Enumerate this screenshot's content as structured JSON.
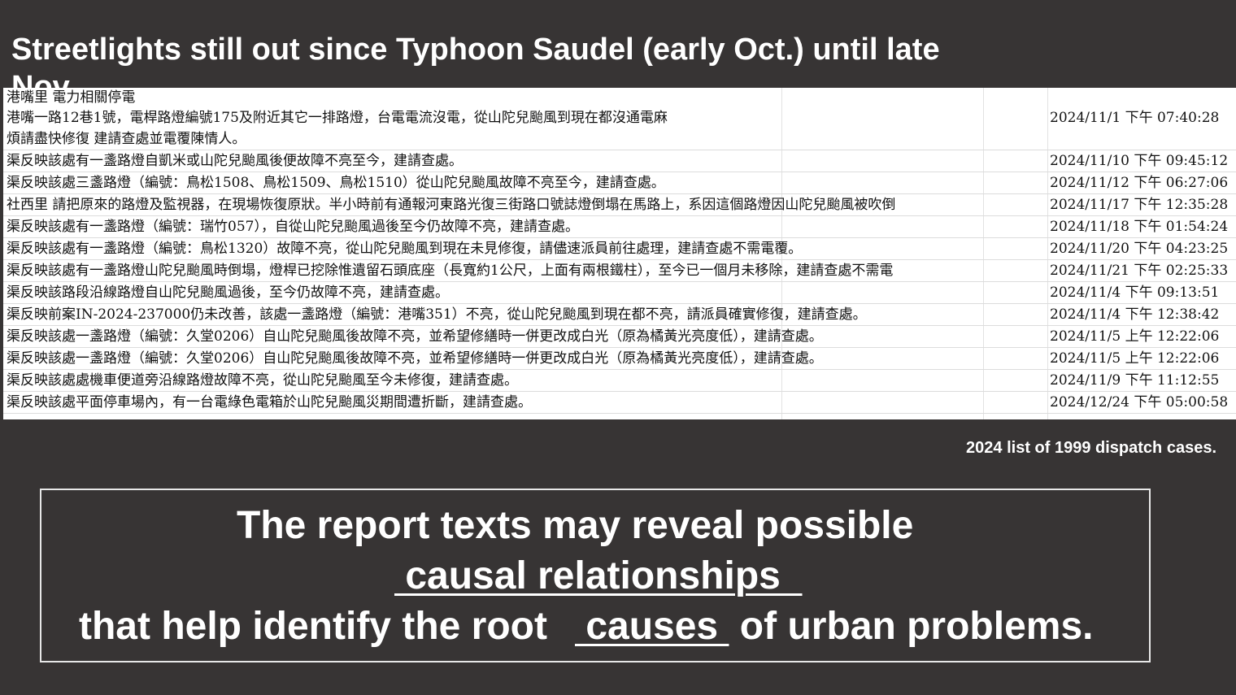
{
  "title": "Streetlights still out since Typhoon Saudel (early Oct.) until late Nov.",
  "sheet": {
    "category_line": "港嘴里 電力相關停電",
    "rows": [
      {
        "text": "港嘴一路12巷1號，電桿路燈編號175及附近其它一排路燈，台電電流沒電，從山陀兒颱風到現在都沒通電麻",
        "text2": "煩請盡快修復 建請查處並電覆陳情人。",
        "date": "2024/11/1 下午 07:40:28"
      },
      {
        "text": "渠反映該處有一盞路燈自凱米或山陀兒颱風後便故障不亮至今，建請查處。",
        "date": "2024/11/10 下午 09:45:12"
      },
      {
        "text": "渠反映該處三盞路燈（編號：鳥松1508、鳥松1509、鳥松1510）從山陀兒颱風故障不亮至今，建請查處。",
        "date": "2024/11/12 下午 06:27:06"
      },
      {
        "text": "社西里 請把原來的路燈及監視器，在現場恢復原狀。半小時前有通報河東路光復三街路口號誌燈倒塌在馬路上，系因這個路燈因山陀兒颱風被吹倒",
        "date": "2024/11/17 下午 12:35:28"
      },
      {
        "text": "渠反映該處有一盞路燈（編號：瑞竹057），自從山陀兒颱風過後至今仍故障不亮，建請查處。",
        "date": "2024/11/18 下午 01:54:24"
      },
      {
        "text": "渠反映該處有一盞路燈（編號：鳥松1320）故障不亮，從山陀兒颱風到現在未見修復，請儘速派員前往處理，建請查處不需電覆。",
        "date": "2024/11/20 下午 04:23:25"
      },
      {
        "text": "渠反映該處有一盞路燈山陀兒颱風時倒塌，燈桿已挖除惟遺留石頭底座（長寬約1公尺，上面有兩根鐵柱），至今已一個月未移除，建請查處不需電",
        "date": "2024/11/21 下午 02:25:33"
      },
      {
        "text": "渠反映該路段沿線路燈自山陀兒颱風過後，至今仍故障不亮，建請查處。",
        "date": "2024/11/4 下午 09:13:51"
      },
      {
        "text": "渠反映前案IN-2024-237000仍未改善，該處一盞路燈（編號：港嘴351）不亮，從山陀兒颱風到現在都不亮，請派員確實修復，建請查處。",
        "date": "2024/11/4 下午 12:38:42"
      },
      {
        "text": "渠反映該處一盞路燈（編號：久堂0206）自山陀兒颱風後故障不亮，並希望修繕時一併更改成白光（原為橘黃光亮度低），建請查處。",
        "date": "2024/11/5 上午 12:22:06"
      },
      {
        "text": "渠反映該處一盞路燈（編號：久堂0206）自山陀兒颱風後故障不亮，並希望修繕時一併更改成白光（原為橘黃光亮度低），建請查處。",
        "date": "2024/11/5 上午 12:22:06"
      },
      {
        "text": "渠反映該處處機車便道旁沿線路燈故障不亮，從山陀兒颱風至今未修復，建請查處。",
        "date": "2024/11/9 下午 11:12:55"
      },
      {
        "text": "渠反映該處平面停車場內，有一台電綠色電箱於山陀兒颱風災期間遭折斷，建請查處。",
        "date": "2024/12/24 下午 05:00:58"
      }
    ]
  },
  "caption": "2024 list of 1999 dispatch cases.",
  "callout": {
    "line1": "The report texts may reveal possible",
    "line2": " causal relationships  ",
    "line3a": "that help identify the root",
    "line3b": " causes ",
    "line3c": "of urban problems."
  },
  "colors": {
    "background": "#373434",
    "sheet": "#ffffff",
    "text": "#ffffff"
  }
}
